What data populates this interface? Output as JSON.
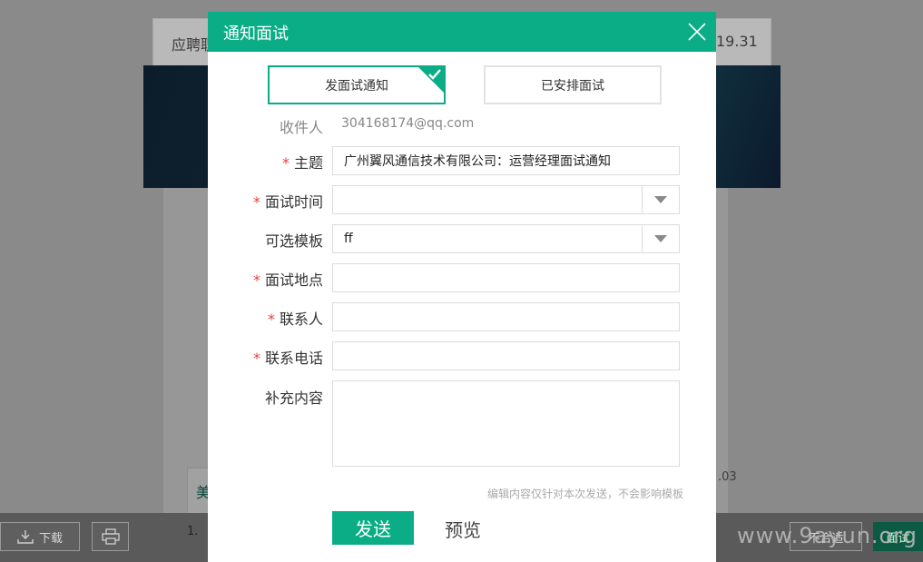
{
  "background": {
    "card_left_text": "应聘职",
    "card_right_text": "19.31",
    "side_char": "美",
    "date_text": ".03",
    "list_number": "1.",
    "download_label": "下载",
    "reject_label": "不合适",
    "interview_label": "面试",
    "watermark": "www.9ayun.org"
  },
  "dialog": {
    "title": "通知面试",
    "tabs": [
      {
        "label": "发面试通知",
        "active": true
      },
      {
        "label": "已安排面试",
        "active": false
      }
    ],
    "recipient": {
      "label": "收件人",
      "value": "304168174@qq.com"
    },
    "subject": {
      "label": "主题",
      "value": "广州翼风通信技术有限公司：运营经理面试通知"
    },
    "interview_time": {
      "label": "面试时间",
      "value": ""
    },
    "template": {
      "label": "可选模板",
      "value": "ff"
    },
    "location": {
      "label": "面试地点",
      "value": ""
    },
    "contact": {
      "label": "联系人",
      "value": ""
    },
    "phone": {
      "label": "联系电话",
      "value": ""
    },
    "extra": {
      "label": "补充内容",
      "value": ""
    },
    "hint": "编辑内容仅针对本次发送，不会影响模板",
    "send_label": "发送",
    "preview_label": "预览",
    "required_mark": "*"
  },
  "colors": {
    "accent": "#0aad85",
    "required": "#e53e3e"
  }
}
